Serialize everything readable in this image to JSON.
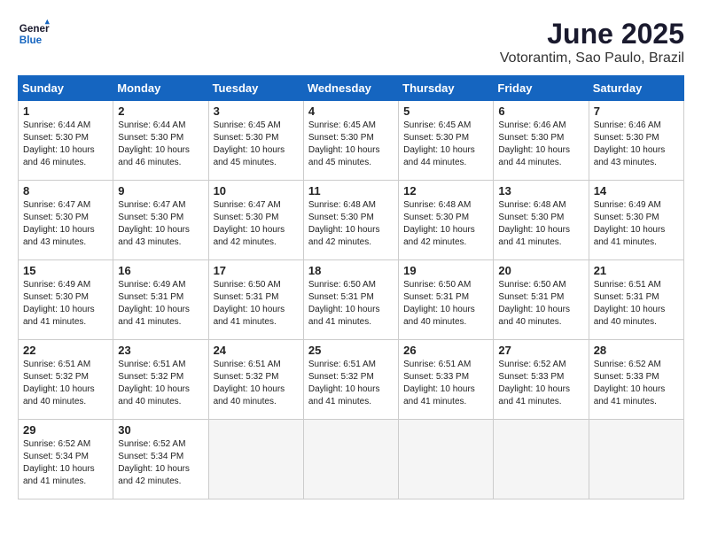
{
  "logo": {
    "line1": "General",
    "line2": "Blue"
  },
  "title": "June 2025",
  "subtitle": "Votorantim, Sao Paulo, Brazil",
  "headers": [
    "Sunday",
    "Monday",
    "Tuesday",
    "Wednesday",
    "Thursday",
    "Friday",
    "Saturday"
  ],
  "weeks": [
    [
      {
        "day": "1",
        "info": "Sunrise: 6:44 AM\nSunset: 5:30 PM\nDaylight: 10 hours\nand 46 minutes."
      },
      {
        "day": "2",
        "info": "Sunrise: 6:44 AM\nSunset: 5:30 PM\nDaylight: 10 hours\nand 46 minutes."
      },
      {
        "day": "3",
        "info": "Sunrise: 6:45 AM\nSunset: 5:30 PM\nDaylight: 10 hours\nand 45 minutes."
      },
      {
        "day": "4",
        "info": "Sunrise: 6:45 AM\nSunset: 5:30 PM\nDaylight: 10 hours\nand 45 minutes."
      },
      {
        "day": "5",
        "info": "Sunrise: 6:45 AM\nSunset: 5:30 PM\nDaylight: 10 hours\nand 44 minutes."
      },
      {
        "day": "6",
        "info": "Sunrise: 6:46 AM\nSunset: 5:30 PM\nDaylight: 10 hours\nand 44 minutes."
      },
      {
        "day": "7",
        "info": "Sunrise: 6:46 AM\nSunset: 5:30 PM\nDaylight: 10 hours\nand 43 minutes."
      }
    ],
    [
      {
        "day": "8",
        "info": "Sunrise: 6:47 AM\nSunset: 5:30 PM\nDaylight: 10 hours\nand 43 minutes."
      },
      {
        "day": "9",
        "info": "Sunrise: 6:47 AM\nSunset: 5:30 PM\nDaylight: 10 hours\nand 43 minutes."
      },
      {
        "day": "10",
        "info": "Sunrise: 6:47 AM\nSunset: 5:30 PM\nDaylight: 10 hours\nand 42 minutes."
      },
      {
        "day": "11",
        "info": "Sunrise: 6:48 AM\nSunset: 5:30 PM\nDaylight: 10 hours\nand 42 minutes."
      },
      {
        "day": "12",
        "info": "Sunrise: 6:48 AM\nSunset: 5:30 PM\nDaylight: 10 hours\nand 42 minutes."
      },
      {
        "day": "13",
        "info": "Sunrise: 6:48 AM\nSunset: 5:30 PM\nDaylight: 10 hours\nand 41 minutes."
      },
      {
        "day": "14",
        "info": "Sunrise: 6:49 AM\nSunset: 5:30 PM\nDaylight: 10 hours\nand 41 minutes."
      }
    ],
    [
      {
        "day": "15",
        "info": "Sunrise: 6:49 AM\nSunset: 5:30 PM\nDaylight: 10 hours\nand 41 minutes."
      },
      {
        "day": "16",
        "info": "Sunrise: 6:49 AM\nSunset: 5:31 PM\nDaylight: 10 hours\nand 41 minutes."
      },
      {
        "day": "17",
        "info": "Sunrise: 6:50 AM\nSunset: 5:31 PM\nDaylight: 10 hours\nand 41 minutes."
      },
      {
        "day": "18",
        "info": "Sunrise: 6:50 AM\nSunset: 5:31 PM\nDaylight: 10 hours\nand 41 minutes."
      },
      {
        "day": "19",
        "info": "Sunrise: 6:50 AM\nSunset: 5:31 PM\nDaylight: 10 hours\nand 40 minutes."
      },
      {
        "day": "20",
        "info": "Sunrise: 6:50 AM\nSunset: 5:31 PM\nDaylight: 10 hours\nand 40 minutes."
      },
      {
        "day": "21",
        "info": "Sunrise: 6:51 AM\nSunset: 5:31 PM\nDaylight: 10 hours\nand 40 minutes."
      }
    ],
    [
      {
        "day": "22",
        "info": "Sunrise: 6:51 AM\nSunset: 5:32 PM\nDaylight: 10 hours\nand 40 minutes."
      },
      {
        "day": "23",
        "info": "Sunrise: 6:51 AM\nSunset: 5:32 PM\nDaylight: 10 hours\nand 40 minutes."
      },
      {
        "day": "24",
        "info": "Sunrise: 6:51 AM\nSunset: 5:32 PM\nDaylight: 10 hours\nand 40 minutes."
      },
      {
        "day": "25",
        "info": "Sunrise: 6:51 AM\nSunset: 5:32 PM\nDaylight: 10 hours\nand 41 minutes."
      },
      {
        "day": "26",
        "info": "Sunrise: 6:51 AM\nSunset: 5:33 PM\nDaylight: 10 hours\nand 41 minutes."
      },
      {
        "day": "27",
        "info": "Sunrise: 6:52 AM\nSunset: 5:33 PM\nDaylight: 10 hours\nand 41 minutes."
      },
      {
        "day": "28",
        "info": "Sunrise: 6:52 AM\nSunset: 5:33 PM\nDaylight: 10 hours\nand 41 minutes."
      }
    ],
    [
      {
        "day": "29",
        "info": "Sunrise: 6:52 AM\nSunset: 5:34 PM\nDaylight: 10 hours\nand 41 minutes."
      },
      {
        "day": "30",
        "info": "Sunrise: 6:52 AM\nSunset: 5:34 PM\nDaylight: 10 hours\nand 42 minutes."
      },
      {
        "day": "",
        "info": ""
      },
      {
        "day": "",
        "info": ""
      },
      {
        "day": "",
        "info": ""
      },
      {
        "day": "",
        "info": ""
      },
      {
        "day": "",
        "info": ""
      }
    ]
  ]
}
